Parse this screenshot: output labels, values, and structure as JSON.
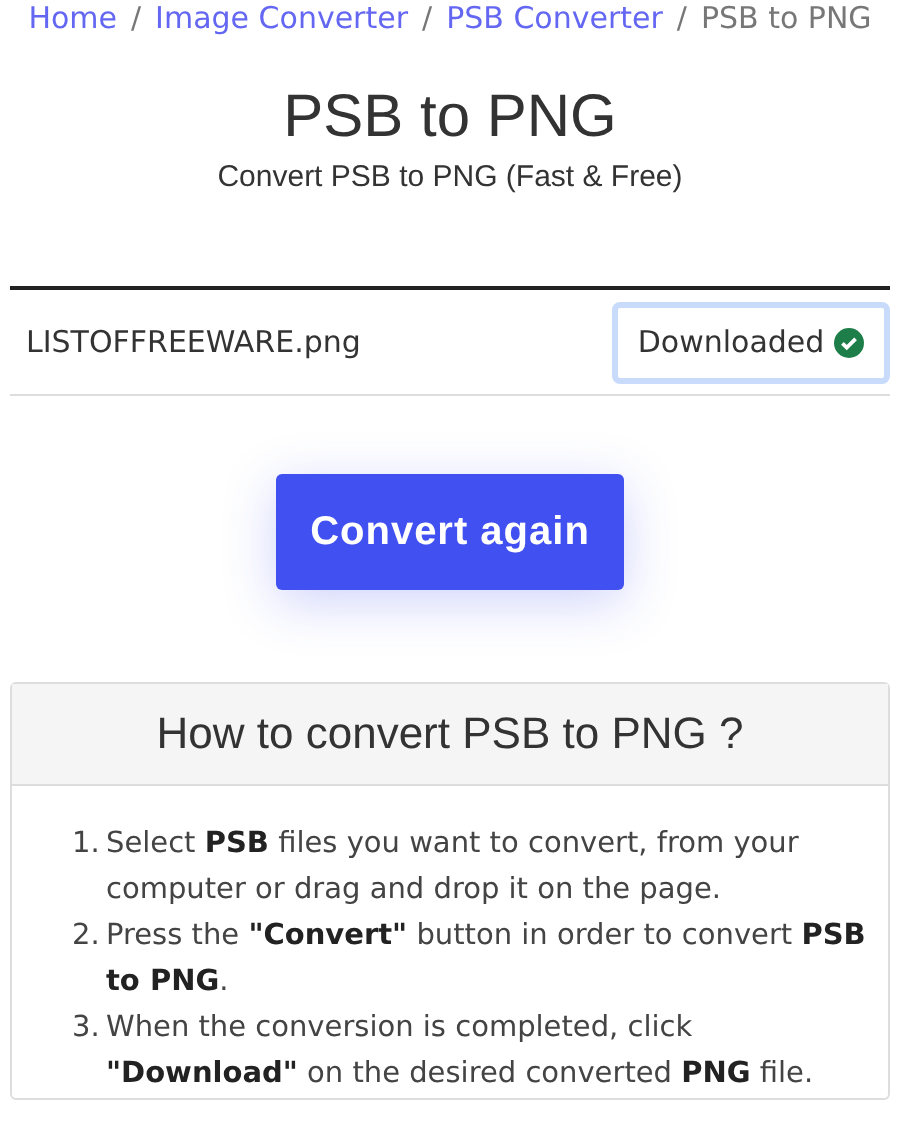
{
  "breadcrumb": [
    {
      "label": "Home",
      "kind": "link"
    },
    {
      "label": "Image Converter",
      "kind": "link"
    },
    {
      "label": "PSB Converter",
      "kind": "link"
    },
    {
      "label": "PSB to PNG",
      "kind": "current"
    }
  ],
  "breadcrumb_separator": "/",
  "title": "PSB to PNG",
  "subtitle": "Convert PSB to PNG (Fast & Free)",
  "file": {
    "name": "LISTOFFREEWARE.png",
    "status": "Downloaded",
    "done": true
  },
  "convert_button": "Convert again",
  "howto": {
    "heading": "How to convert PSB to PNG ?",
    "steps": [
      {
        "number": "1.",
        "text": "Select **PSB** files you want to convert, from your computer or drag and drop it on the page."
      },
      {
        "number": "2.",
        "text": "Press the **\"Convert\"** button in order to convert **PSB to PNG**."
      },
      {
        "number": "3.",
        "text": "When the conversion is completed, click **\"Download\"** on the desired converted **PNG** file."
      }
    ]
  }
}
